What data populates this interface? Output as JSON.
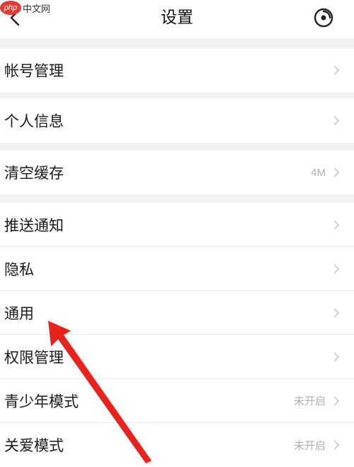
{
  "watermark": {
    "logo": "php",
    "text": "中文网"
  },
  "header": {
    "title": "设置",
    "back_icon": "chevron-left-icon",
    "action_icon": "target-circle-icon"
  },
  "groups": [
    {
      "items": [
        {
          "label": "帐号管理",
          "value": ""
        }
      ]
    },
    {
      "items": [
        {
          "label": "个人信息",
          "value": ""
        }
      ]
    },
    {
      "items": [
        {
          "label": "清空缓存",
          "value": "4M"
        }
      ]
    },
    {
      "items": [
        {
          "label": "推送通知",
          "value": ""
        },
        {
          "label": "隐私",
          "value": ""
        },
        {
          "label": "通用",
          "value": ""
        },
        {
          "label": "权限管理",
          "value": ""
        },
        {
          "label": "青少年模式",
          "value": "未开启"
        },
        {
          "label": "关爱模式",
          "value": "未开启"
        }
      ]
    }
  ],
  "colors": {
    "arrow": "#e8231e",
    "background": "#f2f2f2",
    "chevron": "#c8c8c8"
  }
}
